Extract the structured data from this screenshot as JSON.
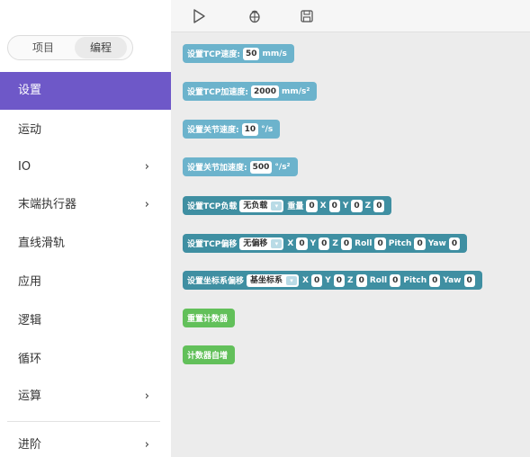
{
  "mode_switch": {
    "project": "项目",
    "program": "编程"
  },
  "categories": [
    {
      "label": "设置",
      "arrow": ""
    },
    {
      "label": "运动",
      "arrow": ""
    },
    {
      "label": "IO",
      "arrow": "›"
    },
    {
      "label": "末端执行器",
      "arrow": "›"
    },
    {
      "label": "直线滑轨",
      "arrow": ""
    },
    {
      "label": "应用",
      "arrow": ""
    },
    {
      "label": "逻辑",
      "arrow": ""
    },
    {
      "label": "循环",
      "arrow": ""
    },
    {
      "label": "运算",
      "arrow": "›"
    },
    {
      "label": "进阶",
      "arrow": "›"
    }
  ],
  "toolbar": {
    "run_icon": "play-icon",
    "debug_icon": "bug-icon",
    "save_icon": "save-icon"
  },
  "blocks": {
    "tcp_speed": {
      "label": "设置TCP速度:",
      "value": "50",
      "unit": "mm/s"
    },
    "tcp_accel": {
      "label": "设置TCP加速度:",
      "value": "2000",
      "unit": "mm/s²"
    },
    "joint_speed": {
      "label": "设置关节速度:",
      "value": "10",
      "unit": "°/s"
    },
    "joint_accel": {
      "label": "设置关节加速度:",
      "value": "500",
      "unit": "°/s²"
    },
    "tcp_load": {
      "label": "设置TCP负载",
      "dropdown": "无负载",
      "weight_label": "重量",
      "weight": "0",
      "x_label": "X",
      "x": "0",
      "y_label": "Y",
      "y": "0",
      "z_label": "Z",
      "z": "0"
    },
    "tcp_offset": {
      "label": "设置TCP偏移",
      "dropdown": "无偏移",
      "x_label": "X",
      "x": "0",
      "y_label": "Y",
      "y": "0",
      "z_label": "Z",
      "z": "0",
      "roll_label": "Roll",
      "roll": "0",
      "pitch_label": "Pitch",
      "pitch": "0",
      "yaw_label": "Yaw",
      "yaw": "0"
    },
    "coord_offset": {
      "label": "设置坐标系偏移",
      "dropdown": "基坐标系",
      "x_label": "X",
      "x": "0",
      "y_label": "Y",
      "y": "0",
      "z_label": "Z",
      "z": "0",
      "roll_label": "Roll",
      "roll": "0",
      "pitch_label": "Pitch",
      "pitch": "0",
      "yaw_label": "Yaw",
      "yaw": "0"
    },
    "reset_counter": {
      "label": "重置计数器"
    },
    "counter_increment": {
      "label": "计数器自增"
    }
  },
  "colors": {
    "accent": "#6e58c8",
    "block_light": "#6cb3cc",
    "block_dark": "#3f8fa2",
    "block_green": "#62c05a",
    "workspace_bg": "#ececec"
  }
}
